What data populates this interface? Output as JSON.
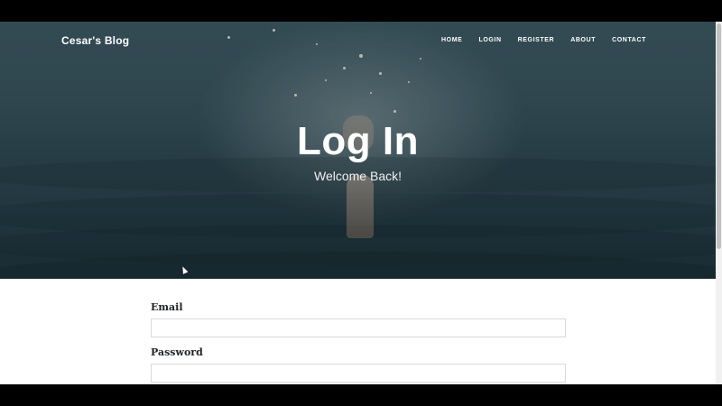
{
  "navbar": {
    "brand": "Cesar's Blog",
    "links": [
      {
        "label": "HOME"
      },
      {
        "label": "LOGIN"
      },
      {
        "label": "REGISTER"
      },
      {
        "label": "ABOUT"
      },
      {
        "label": "CONTACT"
      }
    ]
  },
  "hero": {
    "title": "Log In",
    "subtitle": "Welcome Back!"
  },
  "form": {
    "email_label": "Email",
    "email_value": "",
    "password_label": "Password",
    "password_value": ""
  },
  "colors": {
    "hero_base": "#2f4a54",
    "text_dark": "#212529",
    "input_border": "#d9d9d9"
  }
}
